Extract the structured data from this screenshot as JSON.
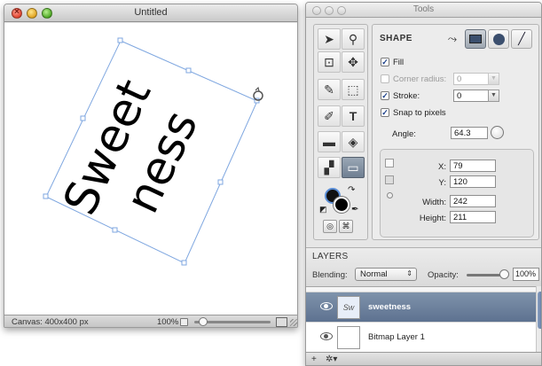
{
  "canvas_window": {
    "title": "Untitled",
    "status_text": "Canvas: 400x400 px",
    "zoom_text": "100%",
    "canvas_text": [
      "Sweet",
      "ness"
    ]
  },
  "tools_window": {
    "title": "Tools",
    "tools": [
      {
        "name": "select-tool",
        "glyph": "➤"
      },
      {
        "name": "zoom-tool",
        "glyph": "🔍"
      },
      {
        "name": "crop-tool",
        "glyph": "⊡"
      },
      {
        "name": "move-tool",
        "glyph": "✥"
      },
      {
        "name": "brush-tool",
        "glyph": "╱"
      },
      {
        "name": "marquee-tool",
        "glyph": "⬚"
      },
      {
        "name": "eraser-tool",
        "glyph": "⌫"
      },
      {
        "name": "text-tool",
        "glyph": "T"
      },
      {
        "name": "rectangle-tool",
        "glyph": "▬"
      },
      {
        "name": "fill-tool",
        "glyph": "◈"
      },
      {
        "name": "clone-tool",
        "glyph": "▞"
      },
      {
        "name": "shape-tool",
        "glyph": "▭"
      }
    ],
    "inspector": {
      "section_title": "SHAPE",
      "fill_label": "Fill",
      "fill_checked": true,
      "corner_radius_label": "Corner radius:",
      "corner_radius_value": "0",
      "stroke_label": "Stroke:",
      "stroke_value": "0",
      "stroke_checked": true,
      "snap_label": "Snap to pixels",
      "snap_checked": true,
      "angle_label": "Angle:",
      "angle_value": "64.3",
      "x_label": "X:",
      "x_value": "79",
      "y_label": "Y:",
      "y_value": "120",
      "width_label": "Width:",
      "width_value": "242",
      "height_label": "Height:",
      "height_value": "211"
    },
    "layers": {
      "title": "LAYERS",
      "blending_label": "Blending:",
      "blending_value": "Normal",
      "opacity_label": "Opacity:",
      "opacity_value": "100%",
      "items": [
        {
          "name": "sweetness",
          "selected": true,
          "thumb_text": "Sw"
        },
        {
          "name": "Bitmap Layer 1",
          "selected": false,
          "thumb_text": ""
        }
      ]
    }
  },
  "colors": {
    "selection_stroke": "#7fa7e0",
    "layer_selected": "#6a7f9c"
  }
}
